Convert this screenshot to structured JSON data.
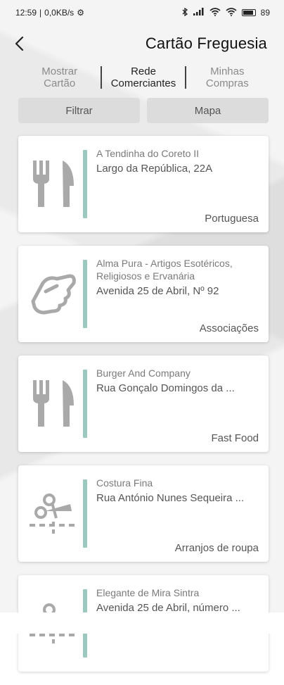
{
  "status_bar": {
    "time": "12:59",
    "separator": "|",
    "network_speed": "0,0KB/s",
    "battery_percent": "89"
  },
  "header": {
    "back_icon": "chevron-left-icon",
    "title": "Cartão Freguesia"
  },
  "tabs": [
    {
      "label": "Mostrar\nCartão",
      "active": false
    },
    {
      "label": "Rede\nComerciantes",
      "active": true
    },
    {
      "label": "Minhas\nCompras",
      "active": false
    }
  ],
  "actions": {
    "filter_label": "Filtrar",
    "map_label": "Mapa"
  },
  "colors": {
    "accent_bar": "#9cc9bf",
    "button_bg": "#dcdcdc",
    "icon_gray": "#a9a9a9"
  },
  "merchants": [
    {
      "name": "A Tendinha do Coreto II",
      "address": "Largo da República, 22A",
      "category": "Portuguesa",
      "icon": "fork-knife-icon"
    },
    {
      "name": "Alma Pura - Artigos Esotéricos, Religiosos e Ervanária",
      "address": "Avenida 25 de Abril, Nº 92",
      "category": "Associações",
      "icon": "handshake-icon"
    },
    {
      "name": "Burger And Company",
      "address": "Rua Gonçalo Domingos da ...",
      "category": "Fast Food",
      "icon": "fork-knife-icon"
    },
    {
      "name": "Costura Fina",
      "address": "Rua António Nunes Sequeira ...",
      "category": "Arranjos de roupa",
      "icon": "scissors-cut-icon"
    },
    {
      "name": "Elegante de Mira Sintra",
      "address": "Avenida 25 de Abril, número ...",
      "category": "",
      "icon": "scissors-cut-icon"
    }
  ]
}
